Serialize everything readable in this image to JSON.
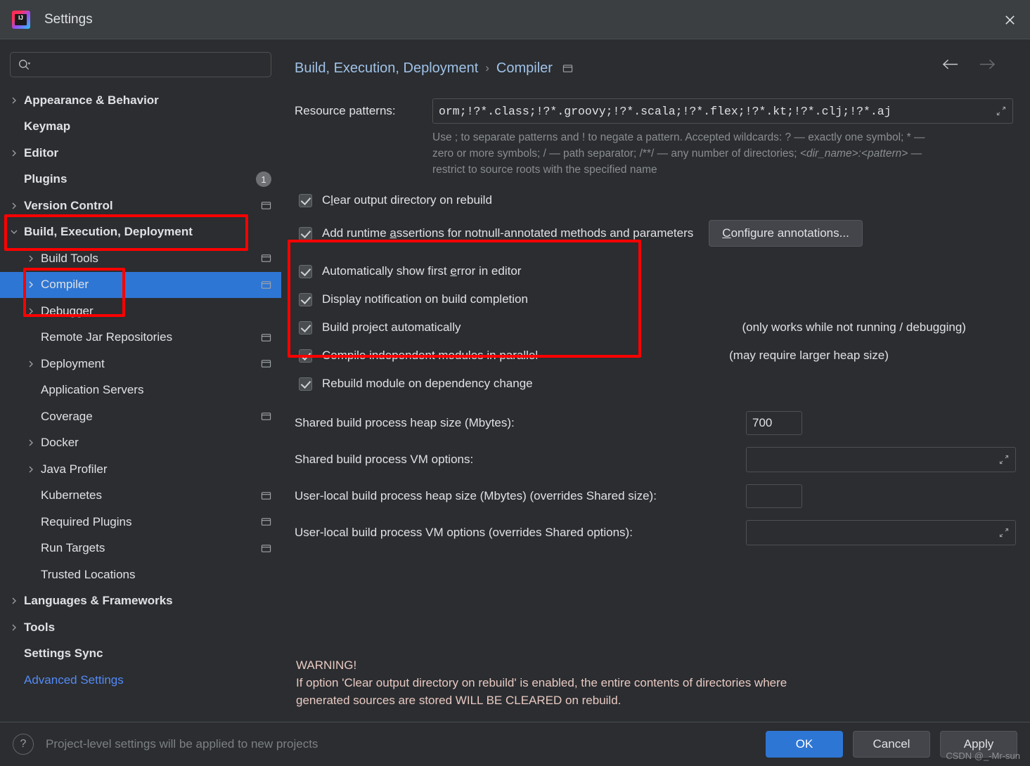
{
  "window": {
    "title": "Settings",
    "logo_icon": "intellij-idea-logo",
    "close_icon": "close-icon"
  },
  "search": {
    "placeholder": "",
    "value": "",
    "icon": "search-icon"
  },
  "sidebar": {
    "items": [
      {
        "label": "Appearance & Behavior",
        "arrow": "chevron-right",
        "level": 0,
        "bold": true,
        "badge": "",
        "project_icon": false,
        "selected": false,
        "link": false
      },
      {
        "label": "Keymap",
        "arrow": "none",
        "level": 0,
        "bold": true,
        "badge": "",
        "project_icon": false,
        "selected": false,
        "link": false
      },
      {
        "label": "Editor",
        "arrow": "chevron-right",
        "level": 0,
        "bold": true,
        "badge": "",
        "project_icon": false,
        "selected": false,
        "link": false
      },
      {
        "label": "Plugins",
        "arrow": "none",
        "level": 0,
        "bold": true,
        "badge": "1",
        "project_icon": false,
        "selected": false,
        "link": false
      },
      {
        "label": "Version Control",
        "arrow": "chevron-right",
        "level": 0,
        "bold": true,
        "badge": "",
        "project_icon": true,
        "selected": false,
        "link": false
      },
      {
        "label": "Build, Execution, Deployment",
        "arrow": "chevron-down",
        "level": 0,
        "bold": true,
        "badge": "",
        "project_icon": false,
        "selected": false,
        "link": false
      },
      {
        "label": "Build Tools",
        "arrow": "chevron-right",
        "level": 1,
        "bold": false,
        "badge": "",
        "project_icon": true,
        "selected": false,
        "link": false
      },
      {
        "label": "Compiler",
        "arrow": "chevron-right",
        "level": 1,
        "bold": false,
        "badge": "",
        "project_icon": true,
        "selected": true,
        "link": false
      },
      {
        "label": "Debugger",
        "arrow": "chevron-right",
        "level": 1,
        "bold": false,
        "badge": "",
        "project_icon": false,
        "selected": false,
        "link": false
      },
      {
        "label": "Remote Jar Repositories",
        "arrow": "none",
        "level": 1,
        "bold": false,
        "badge": "",
        "project_icon": true,
        "selected": false,
        "link": false
      },
      {
        "label": "Deployment",
        "arrow": "chevron-right",
        "level": 1,
        "bold": false,
        "badge": "",
        "project_icon": true,
        "selected": false,
        "link": false
      },
      {
        "label": "Application Servers",
        "arrow": "none",
        "level": 1,
        "bold": false,
        "badge": "",
        "project_icon": false,
        "selected": false,
        "link": false
      },
      {
        "label": "Coverage",
        "arrow": "none",
        "level": 1,
        "bold": false,
        "badge": "",
        "project_icon": true,
        "selected": false,
        "link": false
      },
      {
        "label": "Docker",
        "arrow": "chevron-right",
        "level": 1,
        "bold": false,
        "badge": "",
        "project_icon": false,
        "selected": false,
        "link": false
      },
      {
        "label": "Java Profiler",
        "arrow": "chevron-right",
        "level": 1,
        "bold": false,
        "badge": "",
        "project_icon": false,
        "selected": false,
        "link": false
      },
      {
        "label": "Kubernetes",
        "arrow": "none",
        "level": 1,
        "bold": false,
        "badge": "",
        "project_icon": true,
        "selected": false,
        "link": false
      },
      {
        "label": "Required Plugins",
        "arrow": "none",
        "level": 1,
        "bold": false,
        "badge": "",
        "project_icon": true,
        "selected": false,
        "link": false
      },
      {
        "label": "Run Targets",
        "arrow": "none",
        "level": 1,
        "bold": false,
        "badge": "",
        "project_icon": true,
        "selected": false,
        "link": false
      },
      {
        "label": "Trusted Locations",
        "arrow": "none",
        "level": 1,
        "bold": false,
        "badge": "",
        "project_icon": false,
        "selected": false,
        "link": false
      },
      {
        "label": "Languages & Frameworks",
        "arrow": "chevron-right",
        "level": 0,
        "bold": true,
        "badge": "",
        "project_icon": false,
        "selected": false,
        "link": false
      },
      {
        "label": "Tools",
        "arrow": "chevron-right",
        "level": 0,
        "bold": true,
        "badge": "",
        "project_icon": false,
        "selected": false,
        "link": false
      },
      {
        "label": "Settings Sync",
        "arrow": "none",
        "level": 0,
        "bold": true,
        "badge": "",
        "project_icon": false,
        "selected": false,
        "link": false
      },
      {
        "label": "Advanced Settings",
        "arrow": "none",
        "level": 0,
        "bold": false,
        "badge": "",
        "project_icon": false,
        "selected": false,
        "link": true
      }
    ]
  },
  "breadcrumb": {
    "parent": "Build, Execution, Deployment",
    "separator": "›",
    "current": "Compiler",
    "scope_icon": "project-scope-icon",
    "back_icon": "arrow-left-icon",
    "forward_icon": "arrow-right-icon"
  },
  "resource_patterns": {
    "label": "Resource patterns:",
    "value": "orm;!?*.class;!?*.groovy;!?*.scala;!?*.flex;!?*.kt;!?*.clj;!?*.aj",
    "expand_icon": "expand-icon",
    "help_line1": "Use ; to separate patterns and ! to negate a pattern. Accepted wildcards: ? — exactly one symbol; * —",
    "help_line2_a": "zero or more symbols; / — path separator; /**/ — any number of directories; ",
    "help_line2_i": "<dir_name>:<pattern>",
    "help_line2_b": " —",
    "help_line3": "restrict to source roots with the specified name"
  },
  "checkboxes": {
    "clear_output": {
      "label_a": "C",
      "label_u": "l",
      "label_b": "ear output directory on rebuild",
      "checked": true
    },
    "add_assertions": {
      "label_a": "Add runtime ",
      "label_u": "a",
      "label_b": "ssertions for notnull-annotated methods and parameters",
      "checked": true
    },
    "configure_annotations_button": {
      "label_a": "C",
      "label_u": "C",
      "label_b": "onfigure annotations..."
    },
    "auto_show_error": {
      "label_a": "Automatically show first ",
      "label_u": "e",
      "label_b": "rror in editor",
      "checked": true
    },
    "display_notification": {
      "label_a": "Display notification on build completion",
      "label_u": "",
      "label_b": "",
      "checked": true
    },
    "build_auto": {
      "label_a": "Build project automatically",
      "label_u": "",
      "label_b": "",
      "checked": true,
      "hint": "(only works while not running / debugging)"
    },
    "compile_parallel": {
      "label_a": "Compile independent modules in parallel",
      "label_u": "",
      "label_b": "",
      "checked": true,
      "hint": "(may require larger heap size)"
    },
    "rebuild_module": {
      "label_a": "Rebuild module on dependency change",
      "label_u": "",
      "label_b": "",
      "checked": true
    }
  },
  "fields": {
    "shared_heap": {
      "label": "Shared build process heap size (Mbytes):",
      "value": "700"
    },
    "shared_vm": {
      "label": "Shared build process VM options:",
      "value": "",
      "expand_icon": "expand-icon"
    },
    "user_heap": {
      "label": "User-local build process heap size (Mbytes) (overrides Shared size):",
      "value": ""
    },
    "user_vm": {
      "label": "User-local build process VM options (overrides Shared options):",
      "value": "",
      "expand_icon": "expand-icon"
    }
  },
  "warning": {
    "title": "WARNING!",
    "line1": "If option 'Clear output directory on rebuild' is enabled, the entire contents of directories where",
    "line2": "generated sources are stored WILL BE CLEARED on rebuild."
  },
  "footer": {
    "help_icon": "question-mark-icon",
    "note": "Project-level settings will be applied to new projects",
    "ok": "OK",
    "cancel": "Cancel",
    "apply": "Apply"
  },
  "watermark": "CSDN @_-Mr-sun",
  "colors": {
    "accent": "#2e76d4",
    "annotation": "#ff0000",
    "background": "#2b2d30",
    "titlebar": "#3c3f41",
    "link": "#548af7"
  }
}
